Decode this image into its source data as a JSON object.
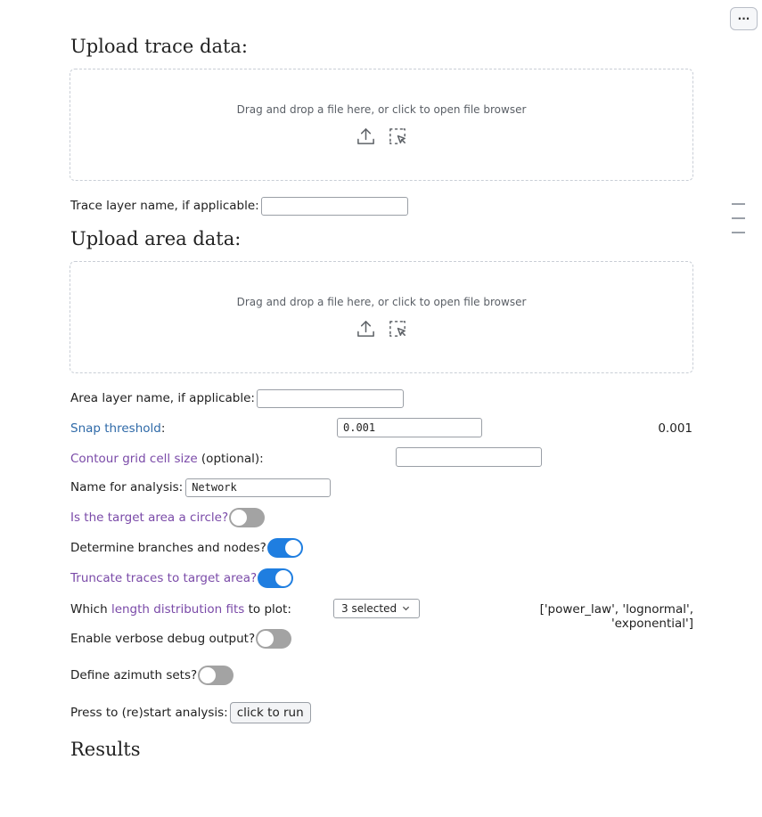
{
  "menu": {
    "label": "···"
  },
  "trace_section": {
    "heading": "Upload trace data:",
    "dropzone_text": "Drag and drop a file here, or click to open file browser",
    "layer_label": "Trace layer name, if applicable:",
    "layer_value": ""
  },
  "area_section": {
    "heading": "Upload area data:",
    "dropzone_text": "Drag and drop a file here, or click to open file browser",
    "layer_label": "Area layer name, if applicable:",
    "layer_value": ""
  },
  "snap": {
    "link": "Snap threshold",
    "suffix": ":",
    "value": "0.001",
    "display": "0.001"
  },
  "contour": {
    "link": "Contour grid cell size",
    "suffix": " (optional):",
    "value": ""
  },
  "analysis_name": {
    "label": "Name for analysis:",
    "value": "Network"
  },
  "circle": {
    "label": "Is the target area a circle?",
    "on": false
  },
  "branches": {
    "label": "Determine branches and nodes?",
    "on": true
  },
  "truncate": {
    "label": "Truncate traces to target area?",
    "on": true
  },
  "fits": {
    "prefix": "Which ",
    "link": "length distribution fits",
    "suffix": " to plot:",
    "selected": "3 selected",
    "display": "['power_law', 'lognormal', 'exponential']"
  },
  "verbose": {
    "label": "Enable verbose debug output?",
    "on": false
  },
  "azimuth": {
    "label": "Define azimuth sets?",
    "on": false
  },
  "run": {
    "label": "Press to (re)start analysis:",
    "button": "click to run"
  },
  "results": {
    "heading": "Results"
  },
  "colors": {
    "accent": "#1f7ee0",
    "link_purple": "#7a4aa8",
    "link_blue": "#2f6aa8"
  }
}
